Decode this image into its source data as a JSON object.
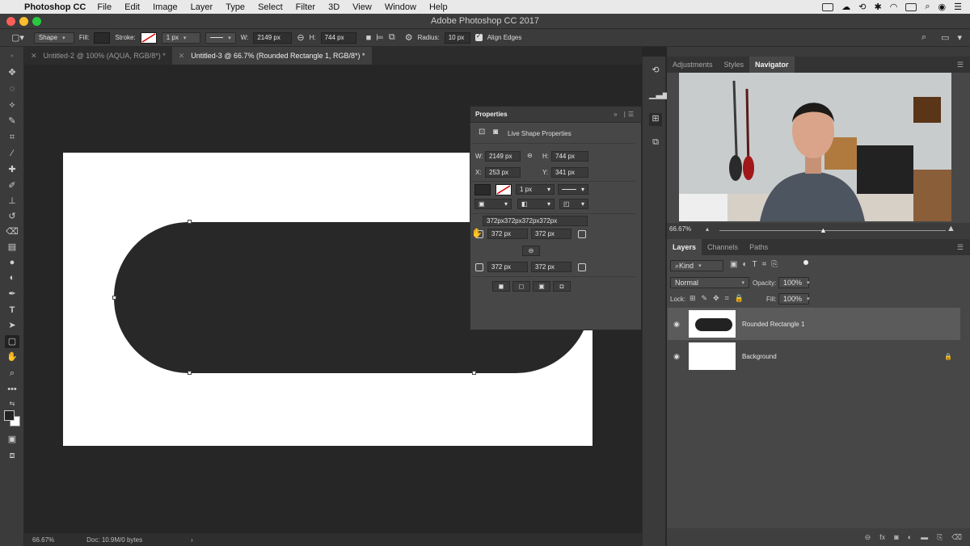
{
  "menubar": {
    "app": "Photoshop CC",
    "items": [
      "File",
      "Edit",
      "Image",
      "Layer",
      "Type",
      "Select",
      "Filter",
      "3D",
      "View",
      "Window",
      "Help"
    ]
  },
  "window": {
    "title": "Adobe Photoshop CC 2017"
  },
  "options": {
    "mode": "Shape",
    "fill_label": "Fill:",
    "stroke_label": "Stroke:",
    "stroke_width": "1 px",
    "w_label": "W:",
    "w_value": "2149 px",
    "h_label": "H:",
    "h_value": "744 px",
    "radius_label": "Radius:",
    "radius_value": "10 px",
    "align_edges": "Align Edges",
    "fill_color": "#2a2a2a"
  },
  "tabs": [
    {
      "label": "Untitled-2 @ 100% (AQUA, RGB/8*) *"
    },
    {
      "label": "Untitled-3 @ 66.7% (Rounded Rectangle 1, RGB/8*) *"
    }
  ],
  "status": {
    "zoom": "66.67%",
    "doc": "Doc: 10.9M/0 bytes"
  },
  "properties": {
    "title": "Properties",
    "subtitle": "Live Shape Properties",
    "w_label": "W:",
    "w_value": "2149 px",
    "h_label": "H:",
    "h_value": "744 px",
    "x_label": "X:",
    "x_value": "253 px",
    "y_label": "Y:",
    "y_value": "341 px",
    "stroke_width": "1 px",
    "radii_summary": "372px372px372px372px",
    "r_tl": "372 px",
    "r_tr": "372 px",
    "r_bl": "372 px",
    "r_br": "372 px"
  },
  "right": {
    "top_tabs": [
      "Adjustments",
      "Styles",
      "Navigator"
    ],
    "nav_zoom": "66.67%",
    "layer_tabs": [
      "Layers",
      "Channels",
      "Paths"
    ],
    "kind": "Kind",
    "blend": "Normal",
    "opacity_label": "Opacity:",
    "opacity": "100%",
    "lock_label": "Lock:",
    "fill_label": "Fill:",
    "fill": "100%",
    "layers": [
      {
        "name": "Rounded Rectangle 1"
      },
      {
        "name": "Background"
      }
    ]
  }
}
